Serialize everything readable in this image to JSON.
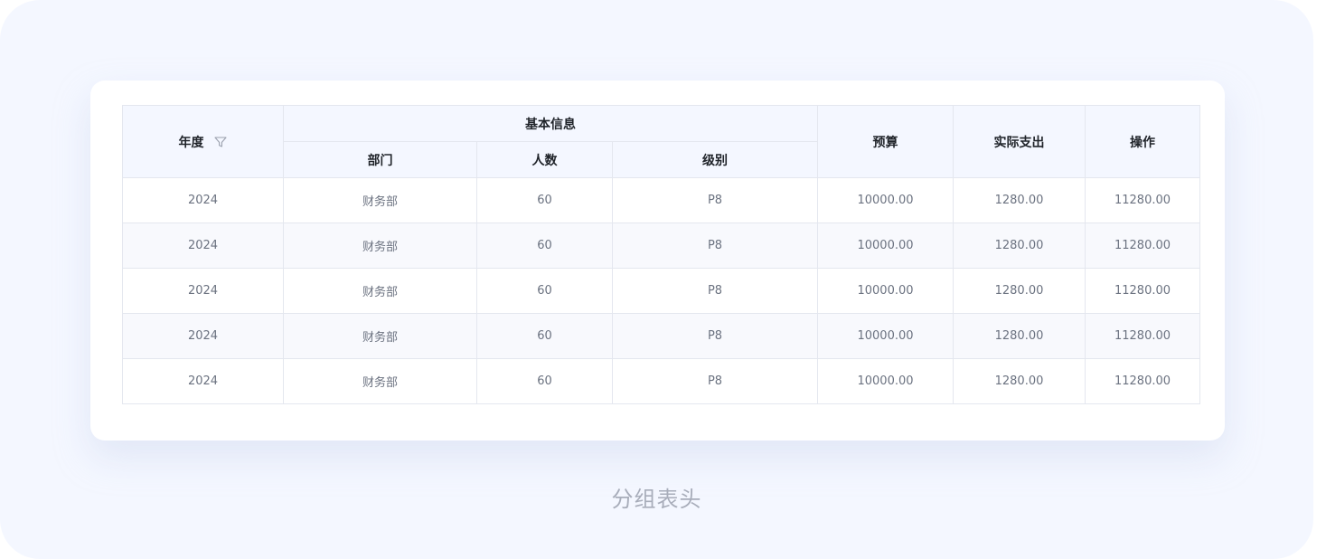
{
  "table": {
    "headers": {
      "year": "年度",
      "group_basic": "基本信息",
      "dept": "部门",
      "count": "人数",
      "level": "级别",
      "budget": "预算",
      "actual": "实际支出",
      "action": "操作"
    },
    "rows": [
      {
        "year": "2024",
        "dept": "财务部",
        "count": "60",
        "level": "P8",
        "budget": "10000.00",
        "actual": "1280.00",
        "action": "11280.00"
      },
      {
        "year": "2024",
        "dept": "财务部",
        "count": "60",
        "level": "P8",
        "budget": "10000.00",
        "actual": "1280.00",
        "action": "11280.00"
      },
      {
        "year": "2024",
        "dept": "财务部",
        "count": "60",
        "level": "P8",
        "budget": "10000.00",
        "actual": "1280.00",
        "action": "11280.00"
      },
      {
        "year": "2024",
        "dept": "财务部",
        "count": "60",
        "level": "P8",
        "budget": "10000.00",
        "actual": "1280.00",
        "action": "11280.00"
      },
      {
        "year": "2024",
        "dept": "财务部",
        "count": "60",
        "level": "P8",
        "budget": "10000.00",
        "actual": "1280.00",
        "action": "11280.00"
      }
    ]
  },
  "caption": "分组表头",
  "icons": {
    "filter": "filter-icon"
  },
  "colors": {
    "page_background": "#f4f7ff",
    "header_background": "#f4f7ff",
    "border": "#e4e7ef",
    "header_text": "#1f2329",
    "cell_text": "#6b7280",
    "caption_text": "#a8adba"
  }
}
